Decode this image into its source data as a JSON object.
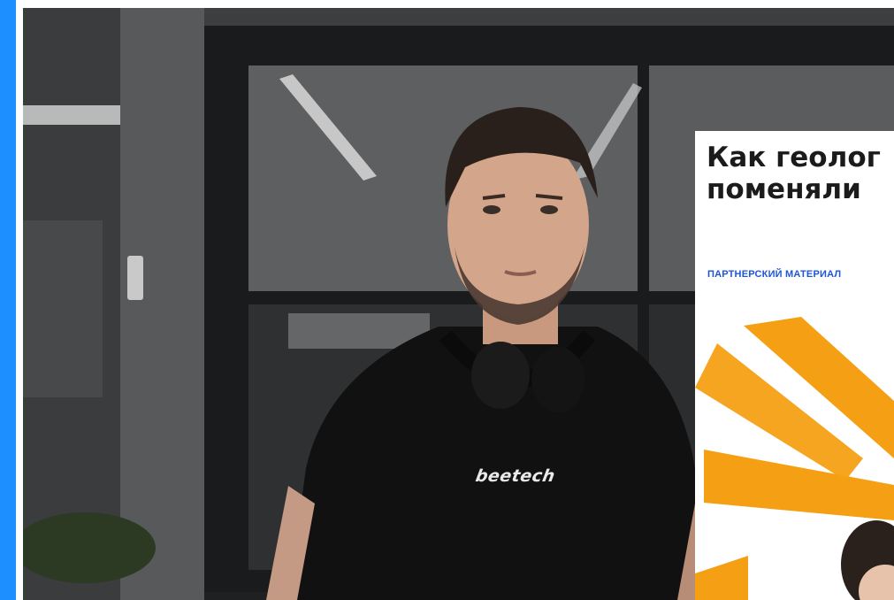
{
  "page": {
    "accent_color": "#1e8fff",
    "photo": {
      "description_icon": "person-photo",
      "shirt_print": "beetech"
    },
    "card": {
      "title": "Как геолог\nпоменяли",
      "tag": "ПАРТНЕРСКИЙ МАТЕРИАЛ",
      "tag_color": "#1e55d8",
      "illustration_color": "#f5a014"
    }
  }
}
